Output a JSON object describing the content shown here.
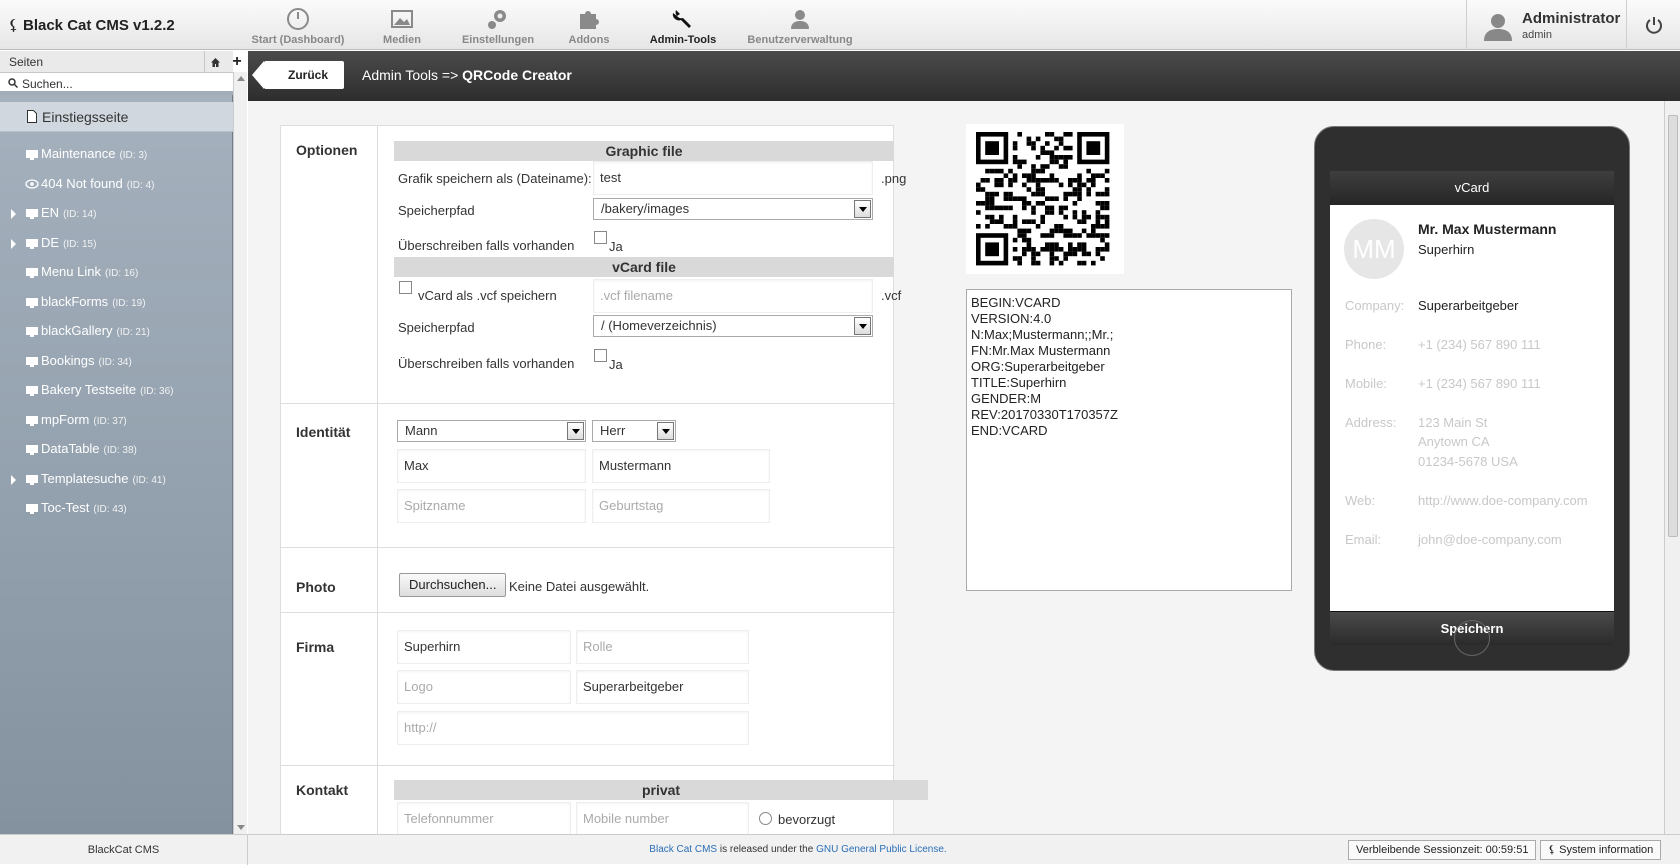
{
  "app": {
    "title": "Black Cat CMS v1.2.2"
  },
  "nav": [
    {
      "label": "Start (Dashboard)",
      "icon": "dashboard-icon"
    },
    {
      "label": "Medien",
      "icon": "media-icon"
    },
    {
      "label": "Einstellungen",
      "icon": "settings-icon"
    },
    {
      "label": "Addons",
      "icon": "puzzle-icon"
    },
    {
      "label": "Admin-Tools",
      "icon": "wrench-icon",
      "active": true
    },
    {
      "label": "Benutzerverwaltung",
      "icon": "users-icon"
    }
  ],
  "user": {
    "name": "Administrator",
    "login": "admin"
  },
  "sidebar": {
    "title": "Seiten",
    "search_placeholder": "Suchen...",
    "root": "Einstiegsseite",
    "items": [
      {
        "label": "Maintenance",
        "id": "(ID: 3)",
        "expandable": false,
        "icon": "monitor-icon"
      },
      {
        "label": "404 Not found",
        "id": "(ID: 4)",
        "expandable": false,
        "icon": "eye-icon"
      },
      {
        "label": "EN",
        "id": "(ID: 14)",
        "expandable": true,
        "icon": "monitor-icon"
      },
      {
        "label": "DE",
        "id": "(ID: 15)",
        "expandable": true,
        "icon": "monitor-icon"
      },
      {
        "label": "Menu Link",
        "id": "(ID: 16)",
        "expandable": false,
        "icon": "monitor-icon"
      },
      {
        "label": "blackForms",
        "id": "(ID: 19)",
        "expandable": false,
        "icon": "monitor-icon"
      },
      {
        "label": "blackGallery",
        "id": "(ID: 21)",
        "expandable": false,
        "icon": "monitor-icon"
      },
      {
        "label": "Bookings",
        "id": "(ID: 34)",
        "expandable": false,
        "icon": "monitor-icon"
      },
      {
        "label": "Bakery Testseite",
        "id": "(ID: 36)",
        "expandable": false,
        "icon": "monitor-icon"
      },
      {
        "label": "mpForm",
        "id": "(ID: 37)",
        "expandable": false,
        "icon": "monitor-icon"
      },
      {
        "label": "DataTable",
        "id": "(ID: 38)",
        "expandable": false,
        "icon": "monitor-icon"
      },
      {
        "label": "Templatesuche",
        "id": "(ID: 41)",
        "expandable": true,
        "icon": "monitor-icon"
      },
      {
        "label": "Toc-Test",
        "id": "(ID: 43)",
        "expandable": false,
        "icon": "monitor-icon"
      }
    ]
  },
  "header": {
    "back": "Zurück",
    "crumb_prefix": "Admin Tools =>",
    "crumb_title": "QRCode Creator"
  },
  "form": {
    "optionen": {
      "title": "Optionen",
      "graphic_head": "Graphic file",
      "filename_label": "Grafik speichern als (Dateiname):",
      "filename_value": "test",
      "filename_ext": ".png",
      "path_label": "Speicherpfad",
      "path_value": "/bakery/images",
      "overwrite_label": "Überschreiben falls vorhanden",
      "ja": "Ja",
      "vcard_head": "vCard file",
      "vcf_save_label": "vCard als .vcf speichern",
      "vcf_filename_placeholder": ".vcf filename",
      "vcf_ext": ".vcf",
      "vcf_path_value": "/ (Homeverzeichnis)"
    },
    "identitaet": {
      "title": "Identität",
      "gender": "Mann",
      "salutation": "Herr",
      "firstname": "Max",
      "lastname": "Mustermann",
      "nickname_placeholder": "Spitzname",
      "birthday_placeholder": "Geburtstag"
    },
    "photo": {
      "title": "Photo",
      "browse": "Durchsuchen...",
      "nofile": "Keine Datei ausgewählt."
    },
    "firma": {
      "title": "Firma",
      "role_value": "Superhirn",
      "role_placeholder": "Rolle",
      "logo_placeholder": "Logo",
      "org_value": "Superarbeitgeber",
      "url_placeholder": "http://"
    },
    "kontakt": {
      "title": "Kontakt",
      "privat_head": "privat",
      "phone_placeholder": "Telefonnummer",
      "mobile_placeholder": "Mobile number",
      "preferred": "bevorzugt"
    }
  },
  "vcard_text": "BEGIN:VCARD\nVERSION:4.0\nN:Max;Mustermann;;Mr.;\nFN:Mr.Max Mustermann\nORG:Superarbeitgeber\nTITLE:Superhirn\nGENDER:M\nREV:20170330T170357Z\nEND:VCARD",
  "preview": {
    "head": "vCard",
    "initials": "MM",
    "name": "Mr. Max Mustermann",
    "title": "Superhirn",
    "company_label": "Company:",
    "company": "Superarbeitgeber",
    "phone_label": "Phone:",
    "phone": "+1 (234) 567 890 111",
    "mobile_label": "Mobile:",
    "mobile": "+1 (234) 567 890 111",
    "address_label": "Address:",
    "address1": "123 Main St",
    "address2": "Anytown CA",
    "address3": "01234-5678 USA",
    "web_label": "Web:",
    "web": "http://www.doe-company.com",
    "email_label": "Email:",
    "email": "john@doe-company.com",
    "save": "Speichern"
  },
  "footer": {
    "left": "BlackCat CMS",
    "lnk1": "Black Cat CMS",
    "mid": "is released under the",
    "lnk2": "GNU General Public License.",
    "session": "Verbleibende Sessionzeit: 00:59:51",
    "sysinfo": "System information"
  },
  "colors": {
    "sidebar": "#8f9cab",
    "toolbar": "#333333"
  }
}
